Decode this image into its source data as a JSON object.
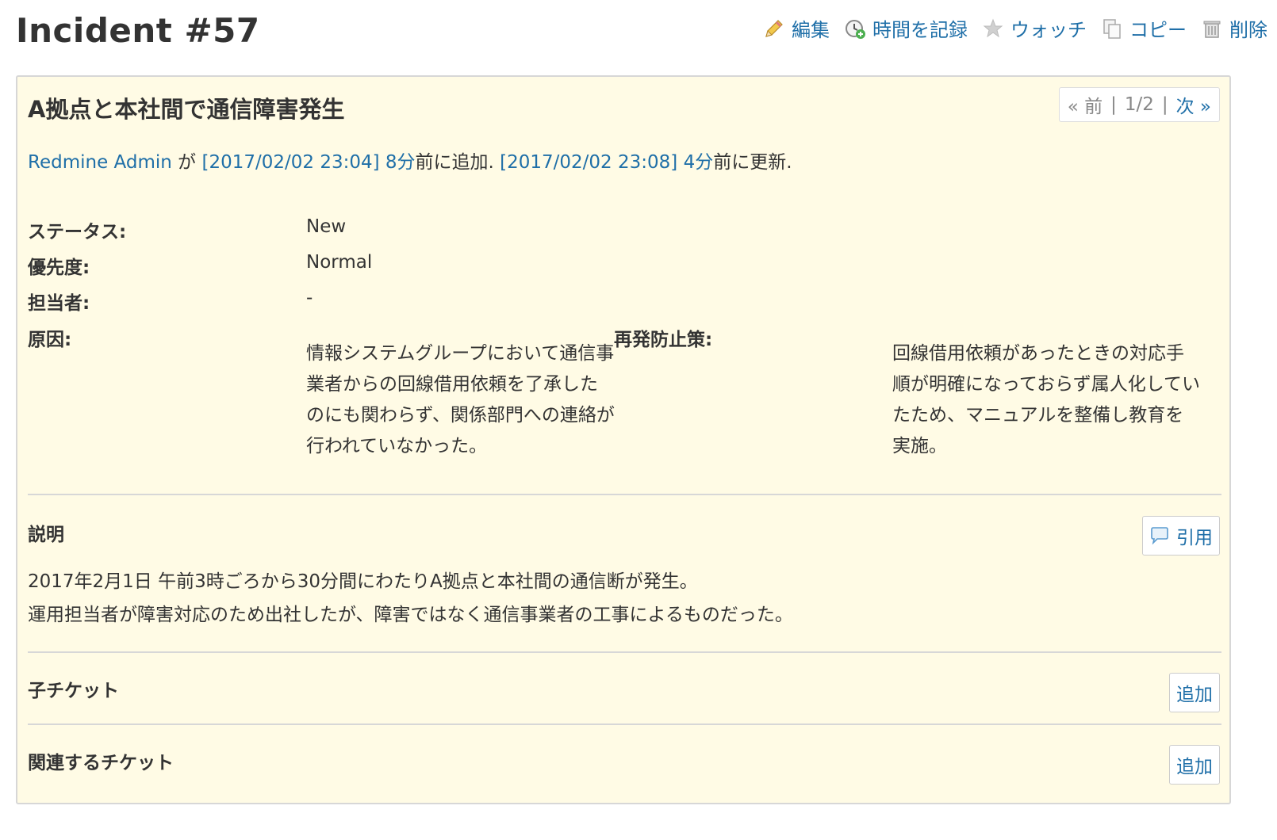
{
  "header": {
    "title": "Incident #57",
    "actions": [
      {
        "label": "編集",
        "icon": "pencil-icon"
      },
      {
        "label": "時間を記録",
        "icon": "clock-add-icon"
      },
      {
        "label": "ウォッチ",
        "icon": "star-icon"
      },
      {
        "label": "コピー",
        "icon": "copy-icon"
      },
      {
        "label": "削除",
        "icon": "trash-icon"
      }
    ]
  },
  "issue": {
    "subject": "A拠点と本社間で通信障害発生",
    "nav": {
      "prev": "« 前",
      "sep1": "|",
      "position": "1/2",
      "sep2": "|",
      "next": "次 »"
    },
    "author": {
      "name": "Redmine Admin",
      "by": "が",
      "created_time": "[2017/02/02 23:04]",
      "created_ago": "8分",
      "created_suffix": "前に追加.",
      "updated_time": "[2017/02/02 23:08]",
      "updated_ago": "4分",
      "updated_suffix": "前に更新."
    },
    "attributes": {
      "status_label": "ステータス:",
      "status_value": "New",
      "priority_label": "優先度:",
      "priority_value": "Normal",
      "assignee_label": "担当者:",
      "assignee_value": "-",
      "cause_label": "原因:",
      "cause_value": "情報システムグループにおいて通信事業者からの回線借用依頼を了承したのにも関わらず、関係部門への連絡が行われていなかった。",
      "prevention_label": "再発防止策:",
      "prevention_value": "回線借用依頼があったときの対応手順が明確になっておらず属人化していたため、マニュアルを整備し教育を実施。"
    },
    "description": {
      "title": "説明",
      "quote_label": "引用",
      "line1": "2017年2月1日 午前3時ごろから30分間にわたりA拠点と本社間の通信断が発生。",
      "line2": "運用担当者が障害対応のため出社したが、障害ではなく通信事業者の工事によるものだった。"
    },
    "subtasks": {
      "title": "子チケット",
      "add_label": "追加"
    },
    "relations": {
      "title": "関連するチケット",
      "add_label": "追加"
    }
  },
  "colors": {
    "link": "#1f6fa8",
    "issue_bg": "#fffbe5",
    "border": "#d7d7d7"
  }
}
